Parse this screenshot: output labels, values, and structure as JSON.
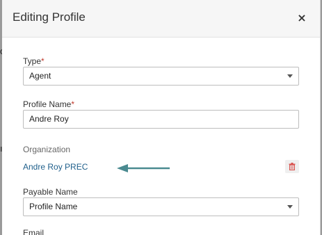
{
  "modal": {
    "title": "Editing Profile",
    "close_label": "×"
  },
  "background_peek": {
    "char_top": "o",
    "char_mid": "ı"
  },
  "form": {
    "type": {
      "label": "Type",
      "required_mark": "*",
      "value": "Agent"
    },
    "profile_name": {
      "label": "Profile Name",
      "required_mark": "*",
      "value": "Andre Roy"
    },
    "organization": {
      "label": "Organization",
      "link_text": "Andre Roy PREC"
    },
    "payable_name": {
      "label": "Payable Name",
      "value": "Profile Name"
    },
    "email": {
      "label": "Email"
    }
  },
  "icons": {
    "trash": "trash-icon",
    "arrow": "arrow-left-icon",
    "dropdown": "chevron-down-icon"
  },
  "colors": {
    "link": "#1f5f8b",
    "arrow": "#4a8a90",
    "required": "#c0392b",
    "trash": "#d9534f"
  }
}
